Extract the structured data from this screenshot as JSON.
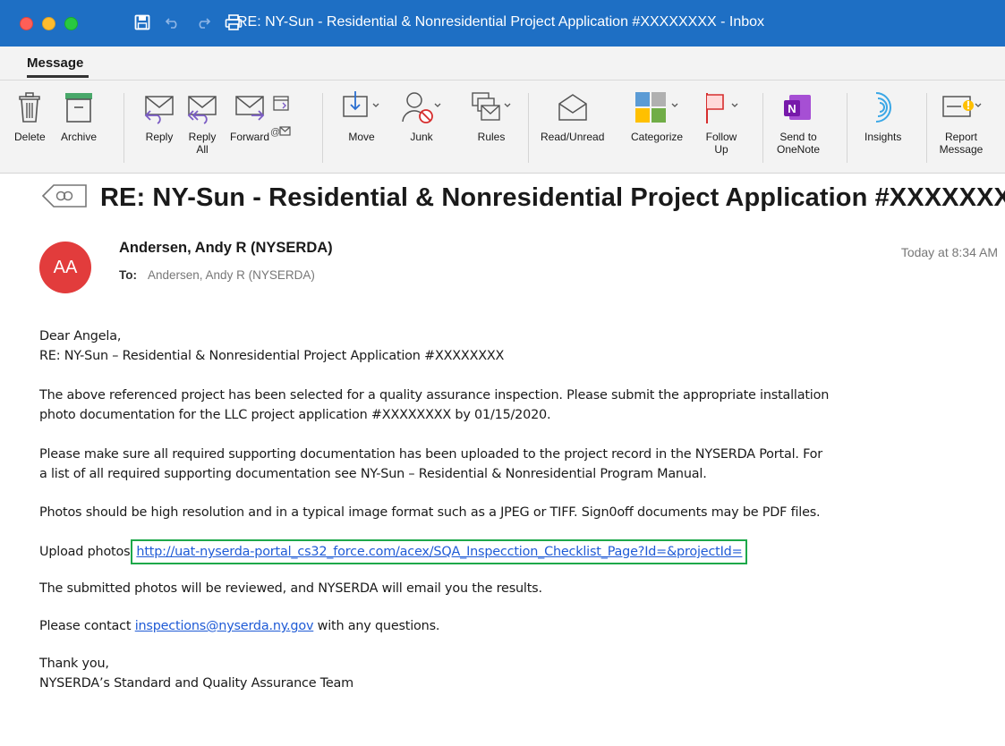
{
  "window": {
    "title": "RE: NY-Sun - Residential & Nonresidential Project Application #XXXXXXXX - Inbox"
  },
  "ribbon": {
    "tab": "Message",
    "buttons": {
      "delete": "Delete",
      "archive": "Archive",
      "reply": "Reply",
      "reply_all": "Reply\nAll",
      "forward": "Forward",
      "move": "Move",
      "junk": "Junk",
      "rules": "Rules",
      "read_unread": "Read/Unread",
      "categorize": "Categorize",
      "follow_up": "Follow\nUp",
      "send_to_onenote": "Send to\nOneNote",
      "insights": "Insights",
      "report_message": "Report\nMessage"
    }
  },
  "email": {
    "subject": "RE: NY-Sun - Residential & Nonresidential Project Application #XXXXXXXX",
    "avatar_initials": "AA",
    "sender": "Andersen, Andy R (NYSERDA)",
    "to_label": "To:",
    "to": "Andersen, Andy R (NYSERDA)",
    "time": "Today at 8:34 AM",
    "body": {
      "greeting": "Dear Angela,",
      "re_line": "RE: NY-Sun – Residential & Nonresidential Project Application #XXXXXXXX",
      "p1_line1": "The above referenced project has been selected for a quality assurance inspection. Please submit the appropriate installation",
      "p1_line2": "photo documentation for the LLC project application #XXXXXXXX by 01/15/2020.",
      "p2_line1": "Please make sure all required supporting documentation has been uploaded to the project record in the NYSERDA Portal. For",
      "p2_line2": "a list of all required supporting documentation see NY-Sun – Residential & Nonresidential Program Manual.",
      "p3": "Photos should be high resolution and in a typical image format such as a JPEG or TIFF. Sign0off documents may be PDF files.",
      "upload_label": "Upload photos",
      "upload_link": "http://uat-nyserda-portal_cs32_force.com/acex/SQA_Inspecction_Checklist_Page?Id=&projectId=",
      "p5": "The submitted photos will be reviewed, and NYSERDA will email you the results.",
      "contact_pre": "Please contact ",
      "contact_email": "inspections@nyserda.ny.gov",
      "contact_post": " with any questions.",
      "thanks": "Thank you,",
      "signature": "NYSERDA’s Standard and Quality Assurance Team"
    }
  },
  "colors": {
    "titlebar": "#1e6fc4",
    "link": "#1f5bd6",
    "highlight_box": "#1da84a",
    "avatar": "#e23c3c",
    "reply_icon": "#7b5cc4"
  }
}
